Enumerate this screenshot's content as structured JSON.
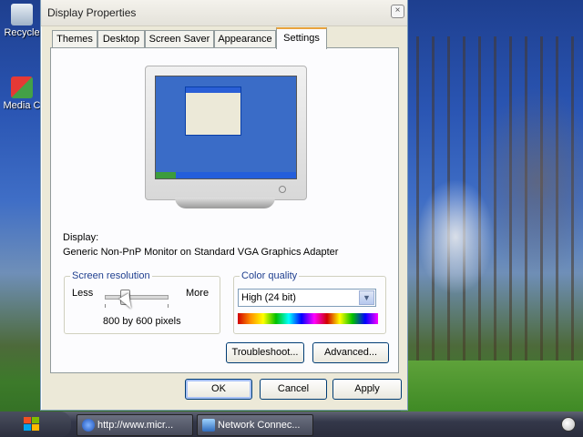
{
  "desktop": {
    "icons": [
      {
        "name": "Recycle"
      },
      {
        "name": "Media C"
      }
    ]
  },
  "window": {
    "title": "Display Properties",
    "close": "×",
    "tabs": [
      "Themes",
      "Desktop",
      "Screen Saver",
      "Appearance",
      "Settings"
    ],
    "active_tab": "Settings",
    "display_label": "Display:",
    "display_value": "Generic Non-PnP Monitor on Standard VGA Graphics Adapter",
    "resolution": {
      "legend": "Screen resolution",
      "less": "Less",
      "more": "More",
      "value": "800 by 600 pixels"
    },
    "color_quality": {
      "legend": "Color quality",
      "selected": "High (24 bit)",
      "arrow": "▼"
    },
    "buttons": {
      "troubleshoot": "Troubleshoot...",
      "advanced": "Advanced...",
      "ok": "OK",
      "cancel": "Cancel",
      "apply": "Apply"
    }
  },
  "taskbar": {
    "tasks": [
      {
        "label": "http://www.micr..."
      },
      {
        "label": "Network Connec..."
      }
    ]
  },
  "colors": {
    "title_accent": "#e8a33d",
    "button_border": "#003c74",
    "desktop_sky": "#2a55b3"
  }
}
